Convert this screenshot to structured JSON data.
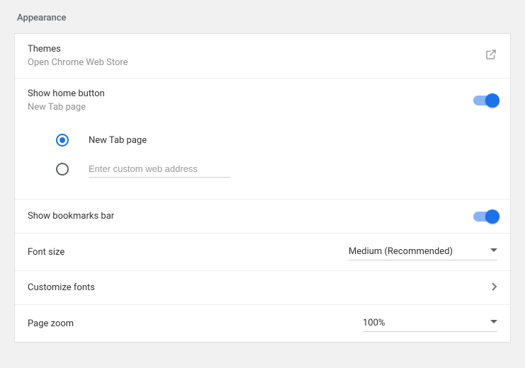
{
  "section_title": "Appearance",
  "themes": {
    "label": "Themes",
    "sublabel": "Open Chrome Web Store"
  },
  "home_button": {
    "label": "Show home button",
    "sublabel": "New Tab page",
    "options": {
      "new_tab_label": "New Tab page",
      "custom_placeholder": "Enter custom web address"
    }
  },
  "bookmarks_bar": {
    "label": "Show bookmarks bar"
  },
  "font_size": {
    "label": "Font size",
    "value": "Medium (Recommended)"
  },
  "customize_fonts": {
    "label": "Customize fonts"
  },
  "page_zoom": {
    "label": "Page zoom",
    "value": "100%"
  }
}
